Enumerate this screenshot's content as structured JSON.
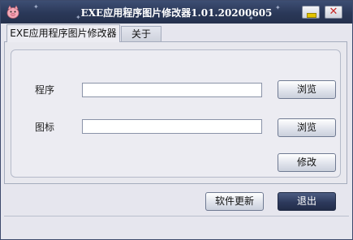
{
  "window": {
    "title": "EXE应用程序图片修改器1.01.20200605",
    "icon": "pig-app-icon",
    "controls": {
      "minimize": "minimize-icon",
      "close": "close-icon"
    }
  },
  "tabs": [
    {
      "label": "EXE应用程序图片修改器",
      "active": true
    },
    {
      "label": "关于",
      "active": false
    }
  ],
  "form": {
    "program_label": "程序",
    "program_value": "",
    "icon_label": "图标",
    "icon_value": "",
    "browse_label_1": "浏览",
    "browse_label_2": "浏览",
    "modify_label": "修改"
  },
  "footer": {
    "update_label": "软件更新",
    "exit_label": "退出"
  },
  "colors": {
    "titlebar": "#2a3858",
    "window_bg": "#e6e6ee",
    "exit_button": "#2d3a5c"
  }
}
